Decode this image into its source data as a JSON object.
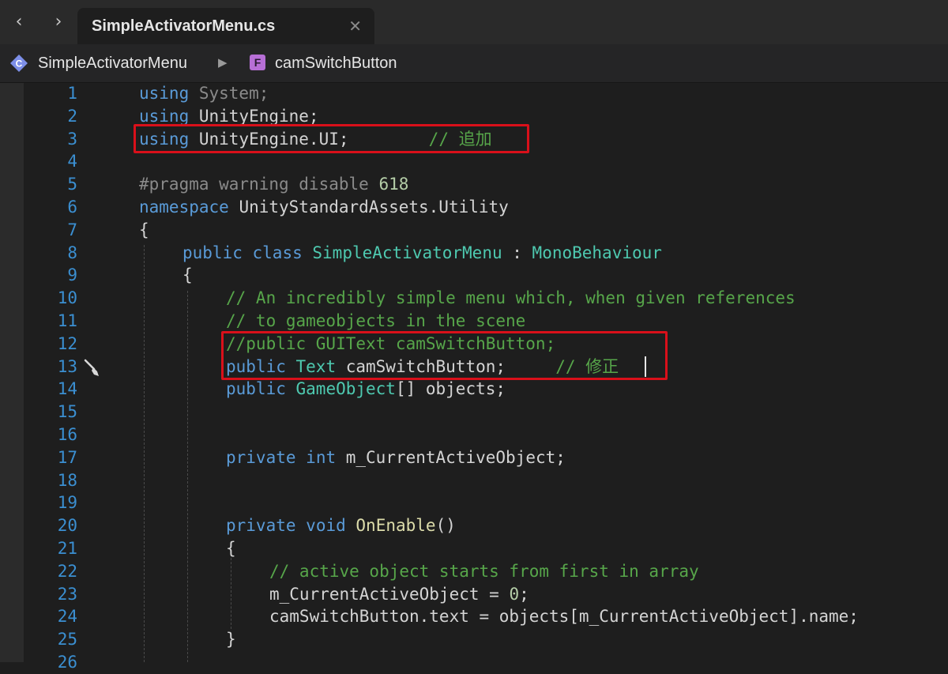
{
  "tab": {
    "title": "SimpleActivatorMenu.cs"
  },
  "breadcrumb": {
    "class_icon_letter": "C",
    "class_name": "SimpleActivatorMenu",
    "field_icon_letter": "F",
    "field_name": "camSwitchButton"
  },
  "icons": {
    "back": "chevron-left-icon",
    "forward": "chevron-right-icon",
    "close": "close-icon",
    "separator": "triangle-right-icon",
    "class": "class-icon",
    "field": "field-icon",
    "quick_action": "paintbrush-icon"
  },
  "colors": {
    "editor_bg": "#1e1e1e",
    "line_number": "#3b8fd1",
    "keyword": "#5a9bd8",
    "type": "#4ec9b0",
    "comment": "#57a64a",
    "highlight_box": "#d9101a"
  },
  "code": {
    "lines": [
      {
        "n": "1",
        "t": [
          [
            "kw",
            "using"
          ],
          [
            "gray",
            " System;"
          ]
        ]
      },
      {
        "n": "2",
        "t": [
          [
            "kw",
            "using"
          ],
          [
            "",
            " UnityEngine;"
          ]
        ]
      },
      {
        "n": "3",
        "t": [
          [
            "kw",
            "using"
          ],
          [
            "",
            " UnityEngine.UI;"
          ],
          [
            "",
            " "
          ],
          [
            "cm",
            "// 追加"
          ]
        ]
      },
      {
        "n": "4",
        "t": []
      },
      {
        "n": "5",
        "t": [
          [
            "gray",
            "#pragma warning disable "
          ],
          [
            "num",
            "618"
          ]
        ]
      },
      {
        "n": "6",
        "t": [
          [
            "kw",
            "namespace"
          ],
          [
            "",
            " UnityStandardAssets.Utility"
          ]
        ]
      },
      {
        "n": "7",
        "t": [
          [
            "",
            "{"
          ]
        ]
      },
      {
        "n": "8",
        "t": [
          [
            "kw",
            "public"
          ],
          [
            "",
            " "
          ],
          [
            "kw",
            "class"
          ],
          [
            "",
            " "
          ],
          [
            "cls",
            "SimpleActivatorMenu"
          ],
          [
            "",
            " : "
          ],
          [
            "cls",
            "MonoBehaviour"
          ]
        ]
      },
      {
        "n": "9",
        "t": [
          [
            "",
            "{"
          ]
        ]
      },
      {
        "n": "10",
        "t": [
          [
            "cm",
            "// An incredibly simple menu which, when given references"
          ]
        ]
      },
      {
        "n": "11",
        "t": [
          [
            "cm",
            "// to gameobjects in the scene"
          ]
        ]
      },
      {
        "n": "12",
        "t": [
          [
            "cm",
            "//public GUIText camSwitchButton;"
          ]
        ]
      },
      {
        "n": "13",
        "t": [
          [
            "kw",
            "public"
          ],
          [
            "",
            " "
          ],
          [
            "cls",
            "Text"
          ],
          [
            "",
            " camSwitchButton;"
          ],
          [
            "",
            " "
          ],
          [
            "cm",
            "// 修正"
          ]
        ]
      },
      {
        "n": "14",
        "t": [
          [
            "kw",
            "public"
          ],
          [
            "",
            " "
          ],
          [
            "cls",
            "GameObject"
          ],
          [
            "",
            "[] objects;"
          ]
        ]
      },
      {
        "n": "15",
        "t": []
      },
      {
        "n": "16",
        "t": []
      },
      {
        "n": "17",
        "t": [
          [
            "kw",
            "private"
          ],
          [
            "",
            " "
          ],
          [
            "kw",
            "int"
          ],
          [
            "",
            " m_CurrentActiveObject;"
          ]
        ]
      },
      {
        "n": "18",
        "t": []
      },
      {
        "n": "19",
        "t": []
      },
      {
        "n": "20",
        "t": [
          [
            "kw",
            "private"
          ],
          [
            "",
            " "
          ],
          [
            "kw",
            "void"
          ],
          [
            "",
            " "
          ],
          [
            "fn",
            "OnEnable"
          ],
          [
            "",
            "()"
          ]
        ]
      },
      {
        "n": "21",
        "t": [
          [
            "",
            "{"
          ]
        ]
      },
      {
        "n": "22",
        "t": [
          [
            "cm",
            "// active object starts from first in array"
          ]
        ]
      },
      {
        "n": "23",
        "t": [
          [
            "",
            "m_CurrentActiveObject = "
          ],
          [
            "num",
            "0"
          ],
          [
            "",
            ";"
          ]
        ]
      },
      {
        "n": "24",
        "t": [
          [
            "",
            "camSwitchButton.text = objects[m_CurrentActiveObject].name;"
          ]
        ]
      },
      {
        "n": "25",
        "t": [
          [
            "",
            "}"
          ]
        ]
      },
      {
        "n": "26",
        "t": []
      }
    ]
  }
}
